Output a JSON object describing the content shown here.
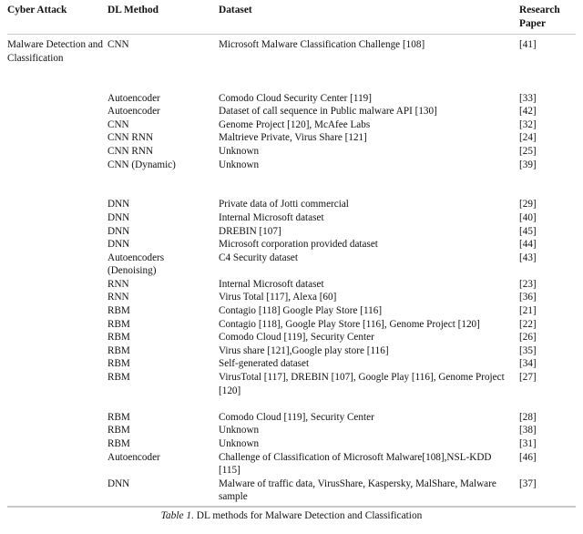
{
  "table": {
    "headers": {
      "cyber_attack": "Cyber Attack",
      "dl_method": "DL Method",
      "dataset": "Dataset",
      "research_paper_line1": "Research",
      "research_paper_line2": "Paper"
    },
    "group_label": "Malware Detection and Classification",
    "rows": [
      {
        "method": "CNN",
        "dataset": "Microsoft Malware Classification Challenge [108]",
        "paper": "[41]"
      },
      {
        "method": "",
        "dataset": "",
        "paper": "",
        "spacer": true
      },
      {
        "method": "",
        "dataset": "",
        "paper": "",
        "spacer": true
      },
      {
        "method": "Autoencoder",
        "dataset": "Comodo Cloud Security Center [119]",
        "paper": "[33]"
      },
      {
        "method": "Autoencoder",
        "dataset": "Dataset of call sequence in Public malware API [130]",
        "paper": "[42]"
      },
      {
        "method": "CNN",
        "dataset": "Genome Project [120], McAfee Labs",
        "paper": "[32]"
      },
      {
        "method": "CNN RNN",
        "dataset": "Maltrieve Private, Virus Share [121]",
        "paper": "[24]"
      },
      {
        "method": "CNN RNN",
        "dataset": "Unknown",
        "paper": "[25]"
      },
      {
        "method": "CNN (Dynamic)",
        "dataset": "Unknown",
        "paper": "[39]"
      },
      {
        "method": "",
        "dataset": "",
        "paper": "",
        "spacer": true
      },
      {
        "method": "",
        "dataset": "",
        "paper": "",
        "spacer": true
      },
      {
        "method": "DNN",
        "dataset": "Private data of Jotti commercial",
        "paper": "[29]"
      },
      {
        "method": "DNN",
        "dataset": "Internal Microsoft dataset",
        "paper": "[40]"
      },
      {
        "method": "DNN",
        "dataset": "DREBIN [107]",
        "paper": "[45]"
      },
      {
        "method": "DNN",
        "dataset": "Microsoft corporation provided dataset",
        "paper": "[44]"
      },
      {
        "method": "Autoencoders (Denoising)",
        "dataset": "C4 Security dataset",
        "paper": "[43]"
      },
      {
        "method": "RNN",
        "dataset": "Internal Microsoft dataset",
        "paper": "[23]"
      },
      {
        "method": "RNN",
        "dataset": "Virus Total [117], Alexa [60]",
        "paper": "[36]"
      },
      {
        "method": "RBM",
        "dataset": "Contagio [118] Google Play Store [116]",
        "paper": "[21]"
      },
      {
        "method": "RBM",
        "dataset": "Contagio [118], Google Play Store [116], Genome Project [120]",
        "paper": "[22]"
      },
      {
        "method": "RBM",
        "dataset": "Comodo Cloud [119], Security Center",
        "paper": "[26]"
      },
      {
        "method": "RBM",
        "dataset": "Virus share [121],Google play store [116]",
        "paper": "[35]"
      },
      {
        "method": "RBM",
        "dataset": "Self-generated dataset",
        "paper": "[34]"
      },
      {
        "method": "RBM",
        "dataset": "VirusTotal [117], DREBIN [107], Google Play [116], Genome Project [120]",
        "paper": "[27]"
      },
      {
        "method": "",
        "dataset": "",
        "paper": "",
        "spacer": true
      },
      {
        "method": "RBM",
        "dataset": "Comodo Cloud [119], Security Center",
        "paper": "[28]"
      },
      {
        "method": "RBM",
        "dataset": "Unknown",
        "paper": "[38]"
      },
      {
        "method": "RBM",
        "dataset": "Unknown",
        "paper": "[31]"
      },
      {
        "method": "Autoencoder",
        "dataset": "Challenge of Classification of Microsoft Malware[108],NSL-KDD [115]",
        "paper": "[46]"
      },
      {
        "method": "DNN",
        "dataset": "Malware of traffic data, VirusShare, Kaspersky, MalShare, Malware sample",
        "paper": "[37]"
      }
    ]
  },
  "caption": {
    "label": "Table 1.",
    "text": " DL methods for Malware Detection and Classification"
  },
  "colors": {
    "text": "#111111",
    "rule": "#c9c9c9",
    "background": "#ffffff"
  }
}
